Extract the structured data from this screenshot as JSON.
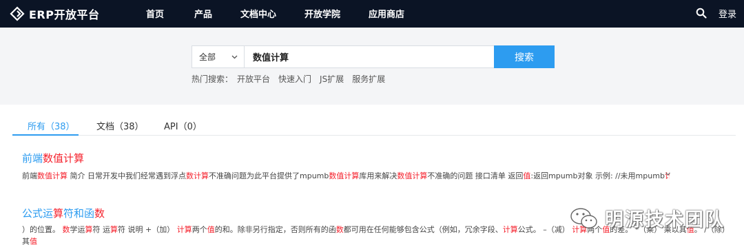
{
  "header": {
    "brand": "ERP开放平台",
    "nav": [
      "首页",
      "产品",
      "文档中心",
      "开放学院",
      "应用商店"
    ],
    "login": "登录"
  },
  "search": {
    "scope": "全部",
    "query": "数值计算",
    "button": "搜索",
    "hot_label": "热门搜索：",
    "hot_links": [
      "开放平台",
      "快速入门",
      "JS扩展",
      "服务扩展"
    ]
  },
  "tabs": [
    {
      "label": "所有（38）",
      "active": true
    },
    {
      "label": "文档（38）",
      "active": false
    },
    {
      "label": "API（0）",
      "active": false
    }
  ],
  "results": [
    {
      "title_parts": [
        {
          "text": "前端",
          "hl": false
        },
        {
          "text": "数值计算",
          "hl": true
        }
      ],
      "snippet_parts": [
        {
          "text": "前端",
          "hl": false
        },
        {
          "text": "数值计算",
          "hl": true
        },
        {
          "text": " 简介 日常开发中我们经常遇到浮点",
          "hl": false
        },
        {
          "text": "数计算",
          "hl": true
        },
        {
          "text": "不准确问题为此平台提供了mpumb",
          "hl": false
        },
        {
          "text": "数值计算",
          "hl": true
        },
        {
          "text": "库用来解决",
          "hl": false
        },
        {
          "text": "数值计算",
          "hl": true
        },
        {
          "text": "不准确的问题 接口清单 返回",
          "hl": false
        },
        {
          "text": "值",
          "hl": true
        },
        {
          "text": ":返回mpumb对象 示例:      //未用mpumb",
          "hl": false
        },
        {
          "text": "计算",
          "hl": true
        }
      ]
    },
    {
      "title_parts": [
        {
          "text": "公式运",
          "hl": false
        },
        {
          "text": "算",
          "hl": true
        },
        {
          "text": "符和函",
          "hl": false
        },
        {
          "text": "数",
          "hl": true
        }
      ],
      "snippet_line1_parts": [
        {
          "text": "）的位置。 ",
          "hl": false
        },
        {
          "text": "数",
          "hl": true
        },
        {
          "text": "学运",
          "hl": false
        },
        {
          "text": "算",
          "hl": true
        },
        {
          "text": "符 运",
          "hl": false
        },
        {
          "text": "算",
          "hl": true
        },
        {
          "text": "符 说明 +（加） ",
          "hl": false
        },
        {
          "text": "计算",
          "hl": true
        },
        {
          "text": "两个",
          "hl": false
        },
        {
          "text": "值",
          "hl": true
        },
        {
          "text": "的和。除非另行指定，否则所有的函",
          "hl": false
        },
        {
          "text": "数",
          "hl": true
        },
        {
          "text": "都可用在任何能够包含公式（例如，冗余字段、",
          "hl": false
        },
        {
          "text": "计算",
          "hl": true
        },
        {
          "text": "公式。 –（减） ",
          "hl": false
        },
        {
          "text": "计算",
          "hl": true
        },
        {
          "text": "两个",
          "hl": false
        },
        {
          "text": "值",
          "hl": true
        },
        {
          "text": "的差。 *（乘） 乘以其",
          "hl": false
        },
        {
          "text": "值",
          "hl": true
        },
        {
          "text": "。 /（除） 除以",
          "hl": false
        }
      ],
      "snippet_line2_parts": [
        {
          "text": "其",
          "hl": false
        },
        {
          "text": "值",
          "hl": true
        }
      ]
    }
  ],
  "watermark": "明源技术团队",
  "colors": {
    "nav_bg": "#0b1425",
    "accent": "#2d9cf0",
    "highlight": "#f5222d",
    "band_bg": "#f4f5f7"
  }
}
